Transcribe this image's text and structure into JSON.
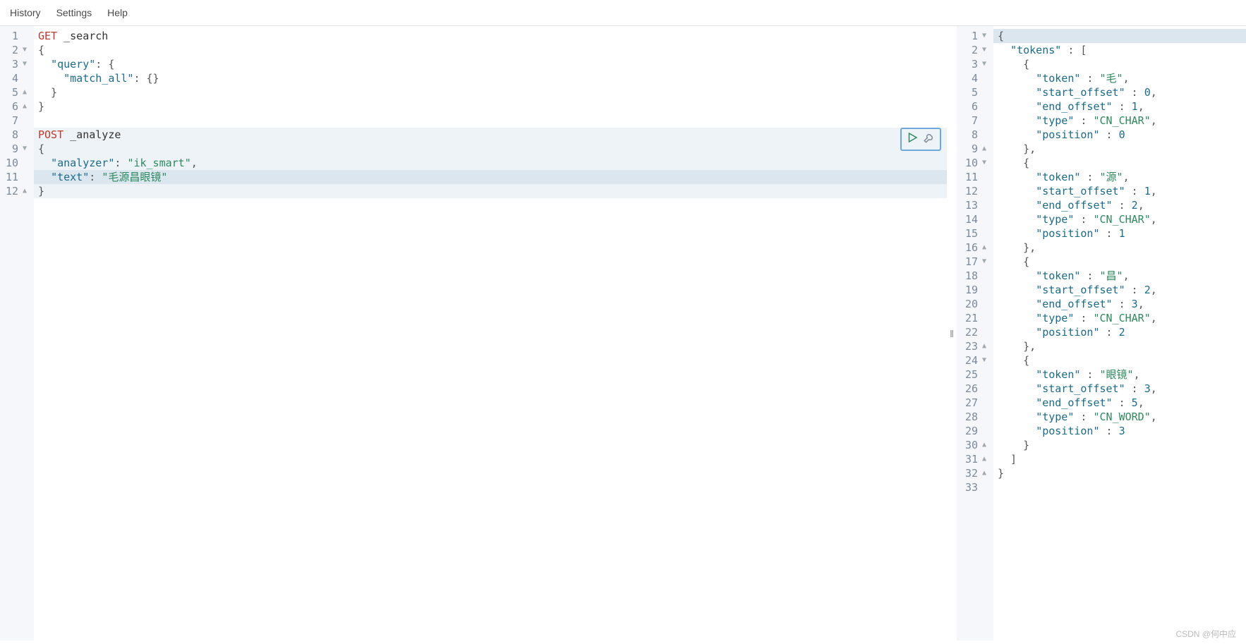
{
  "menu": {
    "history": "History",
    "settings": "Settings",
    "help": "Help"
  },
  "left": {
    "gutter": [
      {
        "n": "1",
        "fold": ""
      },
      {
        "n": "2",
        "fold": "▼"
      },
      {
        "n": "3",
        "fold": "▼"
      },
      {
        "n": "4",
        "fold": ""
      },
      {
        "n": "5",
        "fold": "▲"
      },
      {
        "n": "6",
        "fold": "▲"
      },
      {
        "n": "7",
        "fold": ""
      },
      {
        "n": "8",
        "fold": ""
      },
      {
        "n": "9",
        "fold": "▼"
      },
      {
        "n": "10",
        "fold": ""
      },
      {
        "n": "11",
        "fold": ""
      },
      {
        "n": "12",
        "fold": "▲"
      }
    ],
    "lines": [
      {
        "tokens": [
          {
            "t": "GET",
            "c": "c-method"
          },
          {
            "t": " _search",
            "c": "c-plain"
          }
        ]
      },
      {
        "tokens": [
          {
            "t": "{",
            "c": "c-punct"
          }
        ]
      },
      {
        "tokens": [
          {
            "t": "  ",
            "c": "c-plain"
          },
          {
            "t": "\"query\"",
            "c": "c-key"
          },
          {
            "t": ": {",
            "c": "c-punct"
          }
        ]
      },
      {
        "tokens": [
          {
            "t": "    ",
            "c": "c-plain"
          },
          {
            "t": "\"match_all\"",
            "c": "c-key"
          },
          {
            "t": ": {}",
            "c": "c-punct"
          }
        ]
      },
      {
        "tokens": [
          {
            "t": "  }",
            "c": "c-punct"
          }
        ]
      },
      {
        "tokens": [
          {
            "t": "}",
            "c": "c-punct"
          }
        ]
      },
      {
        "tokens": [
          {
            "t": "",
            "c": "c-plain"
          }
        ]
      },
      {
        "tokens": [
          {
            "t": "POST",
            "c": "c-method"
          },
          {
            "t": " _analyze",
            "c": "c-plain"
          }
        ],
        "hl": "block"
      },
      {
        "tokens": [
          {
            "t": "{",
            "c": "c-punct"
          }
        ],
        "hl": "block"
      },
      {
        "tokens": [
          {
            "t": "  ",
            "c": "c-plain"
          },
          {
            "t": "\"analyzer\"",
            "c": "c-key"
          },
          {
            "t": ": ",
            "c": "c-punct"
          },
          {
            "t": "\"ik_smart\"",
            "c": "c-str"
          },
          {
            "t": ",",
            "c": "c-punct"
          }
        ],
        "hl": "block"
      },
      {
        "tokens": [
          {
            "t": "  ",
            "c": "c-plain"
          },
          {
            "t": "\"text\"",
            "c": "c-key"
          },
          {
            "t": ": ",
            "c": "c-punct"
          },
          {
            "t": "\"毛源昌眼镜\"",
            "c": "c-str"
          }
        ],
        "hl": "line"
      },
      {
        "tokens": [
          {
            "t": "}",
            "c": "c-punct"
          }
        ],
        "hl": "block"
      }
    ]
  },
  "right": {
    "gutter": [
      {
        "n": "1",
        "fold": "▼"
      },
      {
        "n": "2",
        "fold": "▼"
      },
      {
        "n": "3",
        "fold": "▼"
      },
      {
        "n": "4",
        "fold": ""
      },
      {
        "n": "5",
        "fold": ""
      },
      {
        "n": "6",
        "fold": ""
      },
      {
        "n": "7",
        "fold": ""
      },
      {
        "n": "8",
        "fold": ""
      },
      {
        "n": "9",
        "fold": "▲"
      },
      {
        "n": "10",
        "fold": "▼"
      },
      {
        "n": "11",
        "fold": ""
      },
      {
        "n": "12",
        "fold": ""
      },
      {
        "n": "13",
        "fold": ""
      },
      {
        "n": "14",
        "fold": ""
      },
      {
        "n": "15",
        "fold": ""
      },
      {
        "n": "16",
        "fold": "▲"
      },
      {
        "n": "17",
        "fold": "▼"
      },
      {
        "n": "18",
        "fold": ""
      },
      {
        "n": "19",
        "fold": ""
      },
      {
        "n": "20",
        "fold": ""
      },
      {
        "n": "21",
        "fold": ""
      },
      {
        "n": "22",
        "fold": ""
      },
      {
        "n": "23",
        "fold": "▲"
      },
      {
        "n": "24",
        "fold": "▼"
      },
      {
        "n": "25",
        "fold": ""
      },
      {
        "n": "26",
        "fold": ""
      },
      {
        "n": "27",
        "fold": ""
      },
      {
        "n": "28",
        "fold": ""
      },
      {
        "n": "29",
        "fold": ""
      },
      {
        "n": "30",
        "fold": "▲"
      },
      {
        "n": "31",
        "fold": "▲"
      },
      {
        "n": "32",
        "fold": "▲"
      },
      {
        "n": "33",
        "fold": ""
      }
    ],
    "lines": [
      {
        "tokens": [
          {
            "t": "{",
            "c": "c-punct"
          }
        ],
        "hl": "first"
      },
      {
        "tokens": [
          {
            "t": "  ",
            "c": "c-plain"
          },
          {
            "t": "\"tokens\"",
            "c": "c-key"
          },
          {
            "t": " : [",
            "c": "c-punct"
          }
        ]
      },
      {
        "tokens": [
          {
            "t": "    {",
            "c": "c-punct"
          }
        ]
      },
      {
        "tokens": [
          {
            "t": "      ",
            "c": "c-plain"
          },
          {
            "t": "\"token\"",
            "c": "c-key"
          },
          {
            "t": " : ",
            "c": "c-punct"
          },
          {
            "t": "\"毛\"",
            "c": "c-str"
          },
          {
            "t": ",",
            "c": "c-punct"
          }
        ]
      },
      {
        "tokens": [
          {
            "t": "      ",
            "c": "c-plain"
          },
          {
            "t": "\"start_offset\"",
            "c": "c-key"
          },
          {
            "t": " : ",
            "c": "c-punct"
          },
          {
            "t": "0",
            "c": "c-num"
          },
          {
            "t": ",",
            "c": "c-punct"
          }
        ]
      },
      {
        "tokens": [
          {
            "t": "      ",
            "c": "c-plain"
          },
          {
            "t": "\"end_offset\"",
            "c": "c-key"
          },
          {
            "t": " : ",
            "c": "c-punct"
          },
          {
            "t": "1",
            "c": "c-num"
          },
          {
            "t": ",",
            "c": "c-punct"
          }
        ]
      },
      {
        "tokens": [
          {
            "t": "      ",
            "c": "c-plain"
          },
          {
            "t": "\"type\"",
            "c": "c-key"
          },
          {
            "t": " : ",
            "c": "c-punct"
          },
          {
            "t": "\"CN_CHAR\"",
            "c": "c-str"
          },
          {
            "t": ",",
            "c": "c-punct"
          }
        ]
      },
      {
        "tokens": [
          {
            "t": "      ",
            "c": "c-plain"
          },
          {
            "t": "\"position\"",
            "c": "c-key"
          },
          {
            "t": " : ",
            "c": "c-punct"
          },
          {
            "t": "0",
            "c": "c-num"
          }
        ]
      },
      {
        "tokens": [
          {
            "t": "    },",
            "c": "c-punct"
          }
        ]
      },
      {
        "tokens": [
          {
            "t": "    {",
            "c": "c-punct"
          }
        ]
      },
      {
        "tokens": [
          {
            "t": "      ",
            "c": "c-plain"
          },
          {
            "t": "\"token\"",
            "c": "c-key"
          },
          {
            "t": " : ",
            "c": "c-punct"
          },
          {
            "t": "\"源\"",
            "c": "c-str"
          },
          {
            "t": ",",
            "c": "c-punct"
          }
        ]
      },
      {
        "tokens": [
          {
            "t": "      ",
            "c": "c-plain"
          },
          {
            "t": "\"start_offset\"",
            "c": "c-key"
          },
          {
            "t": " : ",
            "c": "c-punct"
          },
          {
            "t": "1",
            "c": "c-num"
          },
          {
            "t": ",",
            "c": "c-punct"
          }
        ]
      },
      {
        "tokens": [
          {
            "t": "      ",
            "c": "c-plain"
          },
          {
            "t": "\"end_offset\"",
            "c": "c-key"
          },
          {
            "t": " : ",
            "c": "c-punct"
          },
          {
            "t": "2",
            "c": "c-num"
          },
          {
            "t": ",",
            "c": "c-punct"
          }
        ]
      },
      {
        "tokens": [
          {
            "t": "      ",
            "c": "c-plain"
          },
          {
            "t": "\"type\"",
            "c": "c-key"
          },
          {
            "t": " : ",
            "c": "c-punct"
          },
          {
            "t": "\"CN_CHAR\"",
            "c": "c-str"
          },
          {
            "t": ",",
            "c": "c-punct"
          }
        ]
      },
      {
        "tokens": [
          {
            "t": "      ",
            "c": "c-plain"
          },
          {
            "t": "\"position\"",
            "c": "c-key"
          },
          {
            "t": " : ",
            "c": "c-punct"
          },
          {
            "t": "1",
            "c": "c-num"
          }
        ]
      },
      {
        "tokens": [
          {
            "t": "    },",
            "c": "c-punct"
          }
        ]
      },
      {
        "tokens": [
          {
            "t": "    {",
            "c": "c-punct"
          }
        ]
      },
      {
        "tokens": [
          {
            "t": "      ",
            "c": "c-plain"
          },
          {
            "t": "\"token\"",
            "c": "c-key"
          },
          {
            "t": " : ",
            "c": "c-punct"
          },
          {
            "t": "\"昌\"",
            "c": "c-str"
          },
          {
            "t": ",",
            "c": "c-punct"
          }
        ]
      },
      {
        "tokens": [
          {
            "t": "      ",
            "c": "c-plain"
          },
          {
            "t": "\"start_offset\"",
            "c": "c-key"
          },
          {
            "t": " : ",
            "c": "c-punct"
          },
          {
            "t": "2",
            "c": "c-num"
          },
          {
            "t": ",",
            "c": "c-punct"
          }
        ]
      },
      {
        "tokens": [
          {
            "t": "      ",
            "c": "c-plain"
          },
          {
            "t": "\"end_offset\"",
            "c": "c-key"
          },
          {
            "t": " : ",
            "c": "c-punct"
          },
          {
            "t": "3",
            "c": "c-num"
          },
          {
            "t": ",",
            "c": "c-punct"
          }
        ]
      },
      {
        "tokens": [
          {
            "t": "      ",
            "c": "c-plain"
          },
          {
            "t": "\"type\"",
            "c": "c-key"
          },
          {
            "t": " : ",
            "c": "c-punct"
          },
          {
            "t": "\"CN_CHAR\"",
            "c": "c-str"
          },
          {
            "t": ",",
            "c": "c-punct"
          }
        ]
      },
      {
        "tokens": [
          {
            "t": "      ",
            "c": "c-plain"
          },
          {
            "t": "\"position\"",
            "c": "c-key"
          },
          {
            "t": " : ",
            "c": "c-punct"
          },
          {
            "t": "2",
            "c": "c-num"
          }
        ]
      },
      {
        "tokens": [
          {
            "t": "    },",
            "c": "c-punct"
          }
        ]
      },
      {
        "tokens": [
          {
            "t": "    {",
            "c": "c-punct"
          }
        ]
      },
      {
        "tokens": [
          {
            "t": "      ",
            "c": "c-plain"
          },
          {
            "t": "\"token\"",
            "c": "c-key"
          },
          {
            "t": " : ",
            "c": "c-punct"
          },
          {
            "t": "\"眼镜\"",
            "c": "c-str"
          },
          {
            "t": ",",
            "c": "c-punct"
          }
        ]
      },
      {
        "tokens": [
          {
            "t": "      ",
            "c": "c-plain"
          },
          {
            "t": "\"start_offset\"",
            "c": "c-key"
          },
          {
            "t": " : ",
            "c": "c-punct"
          },
          {
            "t": "3",
            "c": "c-num"
          },
          {
            "t": ",",
            "c": "c-punct"
          }
        ]
      },
      {
        "tokens": [
          {
            "t": "      ",
            "c": "c-plain"
          },
          {
            "t": "\"end_offset\"",
            "c": "c-key"
          },
          {
            "t": " : ",
            "c": "c-punct"
          },
          {
            "t": "5",
            "c": "c-num"
          },
          {
            "t": ",",
            "c": "c-punct"
          }
        ]
      },
      {
        "tokens": [
          {
            "t": "      ",
            "c": "c-plain"
          },
          {
            "t": "\"type\"",
            "c": "c-key"
          },
          {
            "t": " : ",
            "c": "c-punct"
          },
          {
            "t": "\"CN_WORD\"",
            "c": "c-str"
          },
          {
            "t": ",",
            "c": "c-punct"
          }
        ]
      },
      {
        "tokens": [
          {
            "t": "      ",
            "c": "c-plain"
          },
          {
            "t": "\"position\"",
            "c": "c-key"
          },
          {
            "t": " : ",
            "c": "c-punct"
          },
          {
            "t": "3",
            "c": "c-num"
          }
        ]
      },
      {
        "tokens": [
          {
            "t": "    }",
            "c": "c-punct"
          }
        ]
      },
      {
        "tokens": [
          {
            "t": "  ]",
            "c": "c-punct"
          }
        ]
      },
      {
        "tokens": [
          {
            "t": "}",
            "c": "c-punct"
          }
        ]
      },
      {
        "tokens": [
          {
            "t": "",
            "c": "c-plain"
          }
        ]
      }
    ]
  },
  "watermark": "CSDN @何中应"
}
